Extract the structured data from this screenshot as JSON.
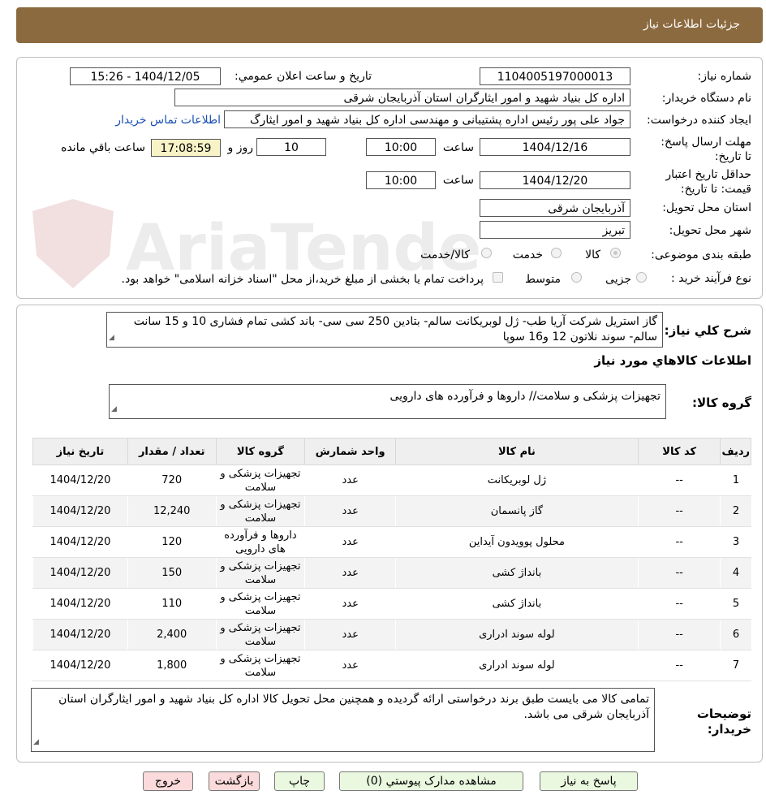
{
  "header": {
    "title": "جزئیات اطلاعات نیاز"
  },
  "form": {
    "need_number_label": "شماره نیاز:",
    "need_number": "1104005197000013",
    "announce_label": "تاریخ و ساعت اعلان عمومي:",
    "announce_value": "1404/12/05 - 15:26",
    "buyer_label": "نام دستگاه خریدار:",
    "buyer_value": "اداره کل بنیاد شهید و امور ایثارگران استان آذربایجان شرقی",
    "creator_label": "ایجاد کننده درخواست:",
    "creator_value": "جواد علی پور رئیس اداره پشتیبانی و مهندسی اداره کل بنیاد شهید و امور ایثارگ",
    "contact_link": "اطلاعات تماس خریدار",
    "deadline_label": "مهلت ارسال پاسخ: تا تاریخ:",
    "deadline_date": "1404/12/16",
    "time_label": "ساعت",
    "deadline_time": "10:00",
    "days_value": "10",
    "day_label": "روز و",
    "remaining_time": "17:08:59",
    "remaining_label": "ساعت باقي مانده",
    "validity_label": "حداقل تاریخ اعتبار قیمت: تا تاریخ:",
    "validity_date": "1404/12/20",
    "validity_time": "10:00",
    "province_label": "استان محل تحویل:",
    "province_value": "آذربایجان شرقی",
    "city_label": "شهر محل تحویل:",
    "city_value": "تبریز",
    "category_label": "طبقه بندی موضوعی:",
    "category_options": [
      "کالا",
      "خدمت",
      "کالا/خدمت"
    ],
    "category_selected": "کالا",
    "process_label": "نوع فرآیند خرید :",
    "process_options": [
      "جزیی",
      "متوسط"
    ],
    "process_selected": "جزیی",
    "payment_note": "پرداخت تمام یا بخشی از مبلغ خرید،از محل \"اسناد خزانه اسلامی\" خواهد بود."
  },
  "summary": {
    "label": "شرح كلي نياز:",
    "value": "گاز استریل شرکت آریا طب- ژل لوبریکانت سالم- بتادین 250 سی سی- باند کشی تمام فشاری 10 و 15 سانت سالم- سوند نلاتون 12 و16 سوپا"
  },
  "items_section": {
    "title": "اطلاعات كالاهاي مورد نياز",
    "group_label": "گروه کالا:",
    "group_value": "تجهیزات پزشکی و سلامت// داروها و فرآورده های دارویی"
  },
  "table": {
    "headers": [
      "ردیف",
      "کد کالا",
      "نام کالا",
      "واحد شمارش",
      "گروه کالا",
      "تعداد / مقدار",
      "تاریخ نیاز"
    ],
    "rows": [
      [
        "1",
        "--",
        "ژل لوبریکانت",
        "عدد",
        "تجهیزات پزشکی و سلامت",
        "720",
        "1404/12/20"
      ],
      [
        "2",
        "--",
        "گاز پانسمان",
        "عدد",
        "تجهیزات پزشکی و سلامت",
        "12,240",
        "1404/12/20"
      ],
      [
        "3",
        "--",
        "محلول پوویدون آیداین",
        "عدد",
        "داروها و فرآورده های دارویی",
        "120",
        "1404/12/20"
      ],
      [
        "4",
        "--",
        "بانداژ کشی",
        "عدد",
        "تجهیزات پزشکی و سلامت",
        "150",
        "1404/12/20"
      ],
      [
        "5",
        "--",
        "بانداژ کشی",
        "عدد",
        "تجهیزات پزشکی و سلامت",
        "110",
        "1404/12/20"
      ],
      [
        "6",
        "--",
        "لوله سوند ادراری",
        "عدد",
        "تجهیزات پزشکی و سلامت",
        "2,400",
        "1404/12/20"
      ],
      [
        "7",
        "--",
        "لوله سوند ادراری",
        "عدد",
        "تجهیزات پزشکی و سلامت",
        "1,800",
        "1404/12/20"
      ]
    ]
  },
  "notes": {
    "label": "توضیحات خریدار:",
    "value": "تمامی کالا می بایست طبق برند درخواستی ارائه گردیده و همچنین محل تحویل کالا اداره کل بنیاد شهید و امور ایثارگران استان آذربایجان شرقی می باشد."
  },
  "buttons": {
    "reply": "پاسخ به نیاز",
    "attachments": "مشاهده مدارک پیوستي (0)",
    "print": "چاپ",
    "back": "بازگشت",
    "exit": "خروج"
  },
  "watermark": "AriaTender.net"
}
